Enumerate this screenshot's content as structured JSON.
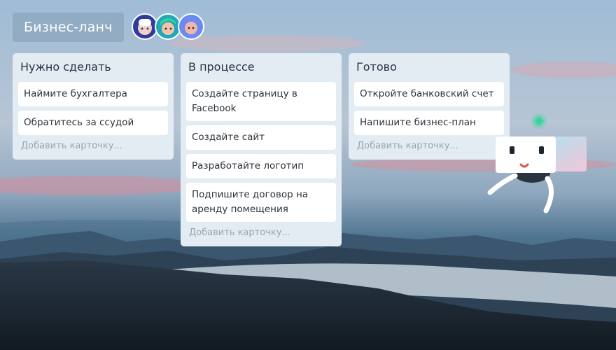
{
  "board": {
    "title": "Бизнес-ланч"
  },
  "members": [
    {
      "name": "member-1",
      "icon": "avatar-icon",
      "color": "#2f3c9e"
    },
    {
      "name": "member-2",
      "icon": "avatar-icon",
      "color": "#20a8b8"
    },
    {
      "name": "member-3",
      "icon": "avatar-icon",
      "color": "#6b8af2"
    }
  ],
  "lists": [
    {
      "title": "Нужно сделать",
      "cards": [
        "Наймите бухгалтера",
        "Обратитесь за ссудой"
      ],
      "add_label": "Добавить карточку..."
    },
    {
      "title": "В процессе",
      "cards": [
        "Создайте страницу в Facebook",
        "Создайте сайт",
        "Разработайте логотип",
        "Подпишите договор на аренду помещения"
      ],
      "add_label": "Добавить карточку..."
    },
    {
      "title": "Готово",
      "cards": [
        "Откройте банковский счет",
        "Напишите бизнес-план"
      ],
      "add_label": "Добавить карточку..."
    }
  ],
  "colors": {
    "list_bg": "#e3ebf3",
    "card_bg": "#ffffff",
    "bot_accent": "#2ed89a"
  }
}
